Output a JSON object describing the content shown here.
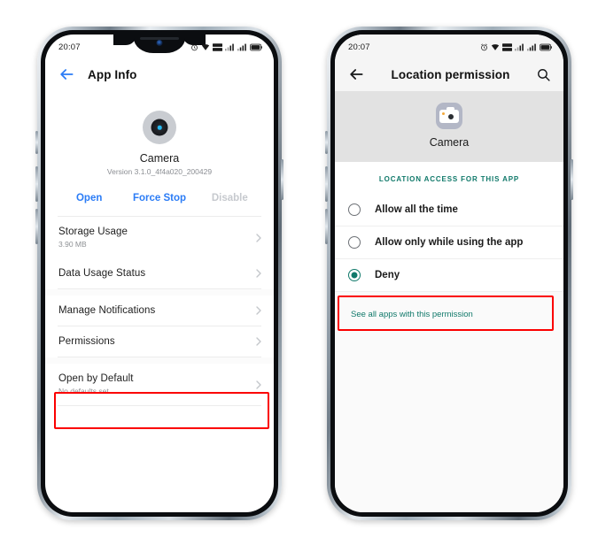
{
  "phone_left": {
    "status_bar": {
      "time": "20:07",
      "icons": [
        "alarm-icon",
        "wifi-icon",
        "volte-icon",
        "signal-bars-icon",
        "signal-bars-2-icon",
        "battery-icon"
      ]
    },
    "app_bar": {
      "back_icon": "back-arrow-icon",
      "title": "App Info"
    },
    "app": {
      "icon": "camera-app-icon",
      "name": "Camera",
      "version": "Version 3.1.0_4f4a020_200429"
    },
    "actions": [
      {
        "label": "Open",
        "disabled": false
      },
      {
        "label": "Force Stop",
        "disabled": false
      },
      {
        "label": "Disable",
        "disabled": true
      }
    ],
    "rows": [
      {
        "title": "Storage Usage",
        "subtitle": "3.90 MB",
        "highlighted": false
      },
      {
        "title": "Data Usage Status",
        "subtitle": "",
        "highlighted": false
      },
      {
        "title": "Manage Notifications",
        "subtitle": "",
        "highlighted": false
      },
      {
        "title": "Permissions",
        "subtitle": "",
        "highlighted": true
      },
      {
        "title": "Open by Default",
        "subtitle": "No defaults set",
        "highlighted": false
      }
    ]
  },
  "phone_right": {
    "status_bar": {
      "time": "20:07",
      "icons": [
        "alarm-icon",
        "wifi-icon",
        "volte-icon",
        "signal-bars-icon",
        "signal-bars-2-icon",
        "battery-icon"
      ]
    },
    "app_bar": {
      "back_icon": "back-arrow-icon",
      "title": "Location permission",
      "search_icon": "search-icon"
    },
    "banner": {
      "icon": "camera-app-icon",
      "app_name": "Camera"
    },
    "section_header": "LOCATION ACCESS FOR THIS APP",
    "options": [
      {
        "label": "Allow all the time",
        "selected": false,
        "highlighted": false
      },
      {
        "label": "Allow only while using the app",
        "selected": false,
        "highlighted": false
      },
      {
        "label": "Deny",
        "selected": true,
        "highlighted": true
      }
    ],
    "footer_link": "See all apps with this permission"
  },
  "colors": {
    "accent_blue": "#2b7cf6",
    "accent_teal": "#10796a",
    "highlight_red": "#fb0000",
    "disabled_grey": "#c6c9ce"
  }
}
